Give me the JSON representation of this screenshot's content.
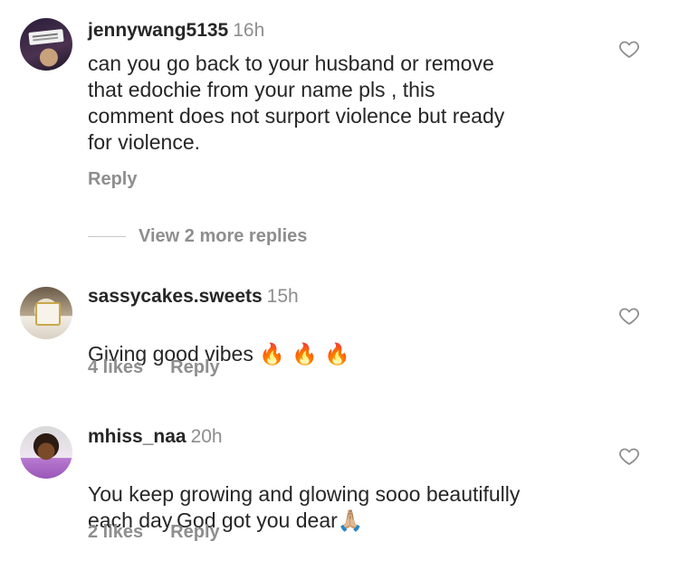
{
  "comments": [
    {
      "username": "jennywang5135",
      "time": "16h",
      "text": "can you go back to your husband or remove\nthat edochie from your name pls , this\ncomment does not surport violence but ready\nfor violence.",
      "reply_label": "Reply",
      "avatar_text": "and you cannot keep my beautiful wife with you"
    },
    {
      "username": "sassycakes.sweets",
      "time": "15h",
      "text": "Giving good vibes",
      "emoji": "🔥 🔥 🔥",
      "likes": "4 likes",
      "reply_label": "Reply"
    },
    {
      "username": "mhiss_naa",
      "time": "20h",
      "text": "You keep growing and glowing sooo beautifully\neach day.God got you dear",
      "emoji": "🙏🏼",
      "likes": "2 likes",
      "reply_label": "Reply"
    }
  ],
  "view_replies": "View 2 more replies",
  "colors": {
    "text": "#262626",
    "muted": "#8e8e8e",
    "divider": "#c7c7c7"
  },
  "icons": {
    "like": "heart-outline-icon"
  }
}
